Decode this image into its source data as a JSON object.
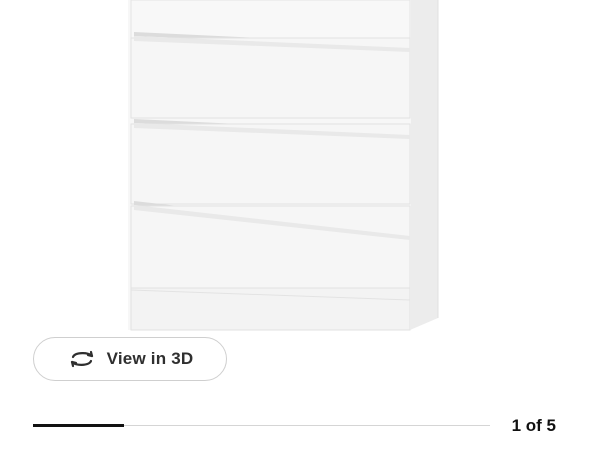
{
  "viewer": {
    "view3d_label": "View in 3D",
    "view3d_icon": "rotate-3d-icon",
    "counter_text": "1 of 5",
    "current_image": 1,
    "total_images": 5,
    "progress_fraction": 0.2
  },
  "colors": {
    "accent_dark": "#111111",
    "track": "#d5d5d5",
    "border": "#cfcfcf"
  }
}
